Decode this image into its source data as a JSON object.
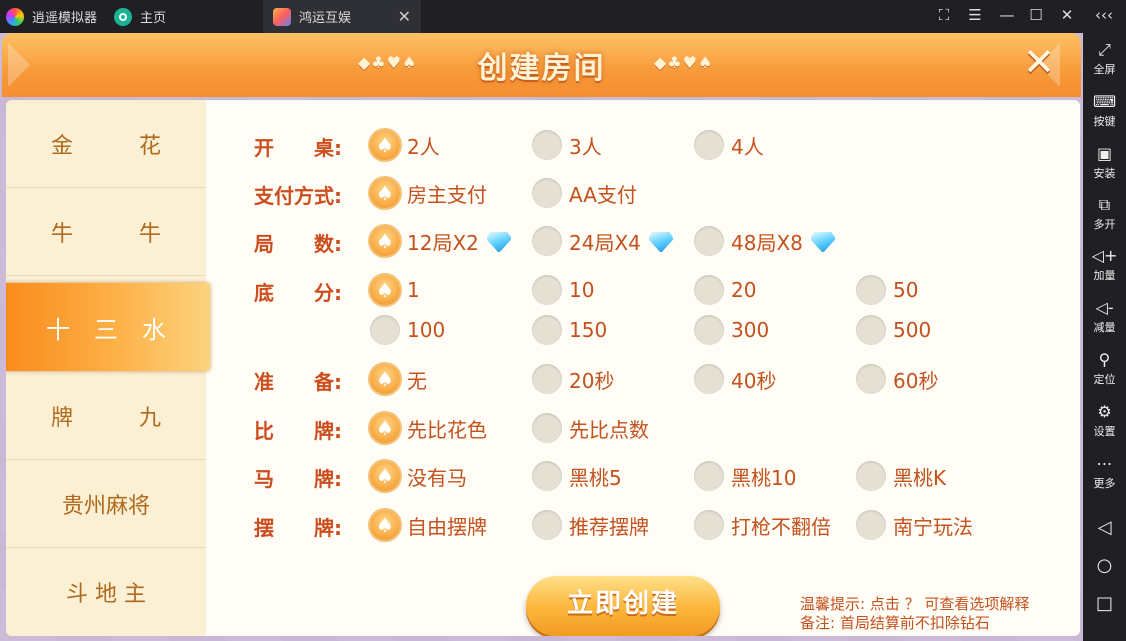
{
  "titlebar": {
    "tabs": [
      {
        "label": "逍遥模拟器"
      },
      {
        "label": "主页"
      },
      {
        "label": "鸿运互娱"
      }
    ]
  },
  "right_sidebar": {
    "items": [
      {
        "label": "全屏",
        "icon": "fullscreen-icon"
      },
      {
        "label": "按键",
        "icon": "keyboard-icon"
      },
      {
        "label": "安装",
        "icon": "apk-icon"
      },
      {
        "label": "多开",
        "icon": "multi-instance-icon"
      },
      {
        "label": "加量",
        "icon": "volume-up-icon"
      },
      {
        "label": "减量",
        "icon": "volume-down-icon"
      },
      {
        "label": "定位",
        "icon": "location-icon"
      },
      {
        "label": "设置",
        "icon": "gear-icon"
      },
      {
        "label": "更多",
        "icon": "more-icon"
      }
    ]
  },
  "dialog": {
    "title": "创建房间",
    "decor": "◆♣♥♠",
    "decor_right": "◆♣♥♠"
  },
  "menu": [
    {
      "label": "金　　　花",
      "active": false
    },
    {
      "label": "牛　　　牛",
      "active": false
    },
    {
      "label": "十　三　水",
      "active": true
    },
    {
      "label": "牌　　　九",
      "active": false
    },
    {
      "label": "贵州麻将",
      "active": false
    },
    {
      "label": "斗 地 主",
      "active": false
    }
  ],
  "rows": [
    {
      "label": "开　　桌:",
      "options": [
        {
          "text": "2人",
          "on": true
        },
        {
          "text": "3人"
        },
        {
          "text": "4人"
        }
      ]
    },
    {
      "label": "支付方式:",
      "options": [
        {
          "text": "房主支付",
          "on": true
        },
        {
          "text": "AA支付"
        }
      ]
    },
    {
      "label": "局　　数:",
      "options": [
        {
          "text": "12局X2",
          "on": true,
          "gem": true
        },
        {
          "text": "24局X4",
          "gem": true
        },
        {
          "text": "48局X8",
          "gem": true
        }
      ]
    },
    {
      "label": "底　　分:",
      "options": [
        {
          "text": "1",
          "on": true
        },
        {
          "text": "10"
        },
        {
          "text": "20"
        },
        {
          "text": "50"
        }
      ]
    },
    {
      "label": "",
      "options": [
        {
          "text": "100"
        },
        {
          "text": "150"
        },
        {
          "text": "300"
        },
        {
          "text": "500"
        }
      ]
    },
    {
      "label": "准　　备:",
      "options": [
        {
          "text": "无",
          "on": true
        },
        {
          "text": "20秒"
        },
        {
          "text": "40秒"
        },
        {
          "text": "60秒"
        }
      ]
    },
    {
      "label": "比　　牌:",
      "options": [
        {
          "text": "先比花色",
          "on": true
        },
        {
          "text": "先比点数"
        }
      ]
    },
    {
      "label": "马　　牌:",
      "options": [
        {
          "text": "没有马",
          "on": true
        },
        {
          "text": "黑桃5"
        },
        {
          "text": "黑桃10"
        },
        {
          "text": "黑桃K"
        }
      ]
    },
    {
      "label": "摆　　牌:",
      "options": [
        {
          "text": "自由摆牌",
          "on": true
        },
        {
          "text": "推荐摆牌"
        },
        {
          "text": "打枪不翻倍"
        },
        {
          "text": "南宁玩法"
        }
      ]
    }
  ],
  "create_button": "立即创建",
  "hint": {
    "line1": "温馨提示: 点击 ？ 可查看选项解释",
    "line2": "备注: 首局结算前不扣除钻石"
  },
  "colors": {
    "accent": "#f79a3a",
    "label": "#cc4e1e"
  }
}
